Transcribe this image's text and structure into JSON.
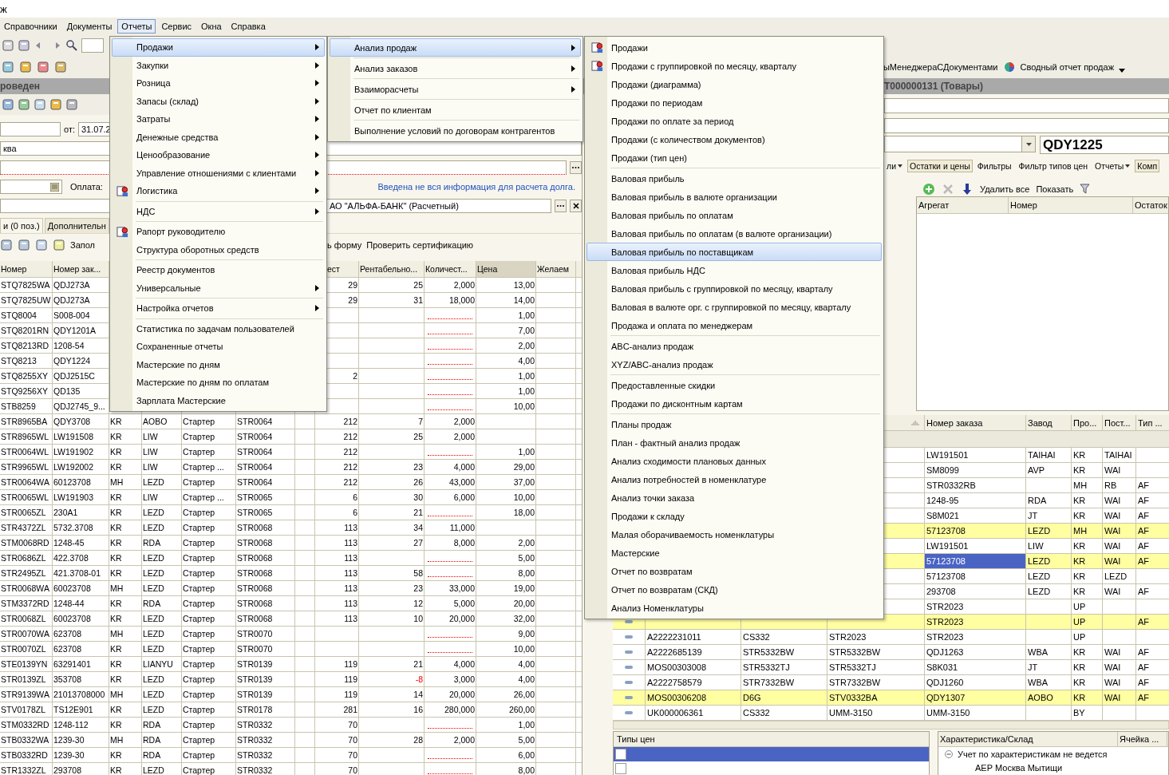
{
  "window": {
    "title": "ж"
  },
  "menubar": [
    {
      "label": "Справочники",
      "selected": false
    },
    {
      "label": "Документы",
      "selected": false
    },
    {
      "label": "Отчеты",
      "selected": true
    },
    {
      "label": "Сервис",
      "selected": false
    },
    {
      "label": "Окна",
      "selected": false
    },
    {
      "label": "Справка",
      "selected": false
    }
  ],
  "quick_reports": {
    "cut_item": "ыМенеджераСДокументами",
    "summary": "Сводный отчет продаж"
  },
  "document_header": {
    "left_title": "роведен",
    "right_title": "T000000131 (Товары)"
  },
  "form": {
    "date_label": "от:",
    "date_value": "31.07.2",
    "field_2": "ква",
    "payment_label": "Оплата:",
    "debt_link": "Введена не вся информация для расчета долга.",
    "bank_account": "АО \"АЛЬФА-БАНК\" (Расчетный)"
  },
  "tabs": [
    {
      "label": "и (0 поз.)",
      "selected": true
    },
    {
      "label": "Дополнительн",
      "selected": false
    }
  ],
  "goods_toolbar": {
    "fill": "Запол",
    "form": "ь форму",
    "check": "Проверить сертификацию"
  },
  "goods_table": {
    "headers": [
      {
        "label": "Номер",
        "selected": false
      },
      {
        "label": "Номер зак...",
        "selected": false
      },
      {
        "label": "ест",
        "selected": false
      },
      {
        "label": "Рентабельно...",
        "selected": false
      },
      {
        "label": "Количест...",
        "selected": false
      },
      {
        "label": "Цена",
        "selected": true
      },
      {
        "label": "Желаем",
        "selected": false
      }
    ],
    "rows": [
      [
        "STQ7825WA",
        "QDJ273A",
        null,
        null,
        null,
        null,
        null,
        "29",
        "25",
        "2,000",
        "13,00",
        null
      ],
      [
        "STQ7825UW",
        "QDJ273A",
        null,
        null,
        null,
        null,
        null,
        "29",
        "31",
        "18,000",
        "14,00",
        null
      ],
      [
        "STQ8004",
        "S008-004",
        null,
        null,
        null,
        null,
        null,
        null,
        null,
        null,
        "1,00",
        null
      ],
      [
        "STQ8201RN",
        "QDY1201A",
        null,
        null,
        null,
        null,
        null,
        null,
        null,
        null,
        "7,00",
        null
      ],
      [
        "STQ8213RD",
        "1208-54",
        null,
        null,
        null,
        null,
        null,
        null,
        null,
        null,
        "2,00",
        null
      ],
      [
        "STQ8213",
        "QDY1224",
        null,
        null,
        null,
        null,
        null,
        null,
        null,
        null,
        "4,00",
        null
      ],
      [
        "STQ8255XY",
        "QDJ2515C",
        null,
        null,
        null,
        null,
        null,
        "2",
        null,
        null,
        "1,00",
        null
      ],
      [
        "STQ9256XY",
        "QD135",
        null,
        null,
        null,
        null,
        null,
        null,
        null,
        null,
        "1,00",
        null
      ],
      [
        "STB8259",
        "QDJ2745_9...",
        null,
        null,
        null,
        null,
        null,
        null,
        null,
        null,
        "10,00",
        null
      ],
      [
        "STR8965BA",
        "QDY3708",
        "KR",
        "AOBO",
        "Стартер",
        "STR0064",
        null,
        "212",
        "7",
        "2,000",
        null,
        null
      ],
      [
        "STR8965WL",
        "LW191508",
        "KR",
        "LIW",
        "Стартер",
        "STR0064",
        null,
        "212",
        "25",
        "2,000",
        null,
        null
      ],
      [
        "STR0064WL",
        "LW191902",
        "KR",
        "LIW",
        "Стартер",
        "STR0064",
        null,
        "212",
        null,
        null,
        "1,00",
        null
      ],
      [
        "STR9965WL",
        "LW192002",
        "KR",
        "LIW",
        "Стартер ...",
        "STR0064",
        null,
        "212",
        "23",
        "4,000",
        "29,00",
        null
      ],
      [
        "STR0064WA",
        "60123708",
        "MH",
        "LEZD",
        "Стартер",
        "STR0064",
        null,
        "212",
        "26",
        "43,000",
        "37,00",
        null
      ],
      [
        "STR0065WL",
        "LW191903",
        "KR",
        "LIW",
        "Стартер ...",
        "STR0065",
        null,
        "6",
        "30",
        "6,000",
        "10,00",
        null
      ],
      [
        "STR0065ZL",
        "230A1",
        "KR",
        "LEZD",
        "Стартер",
        "STR0065",
        null,
        "6",
        "21",
        null,
        "18,00",
        null
      ],
      [
        "STR4372ZL",
        "5732.3708",
        "KR",
        "LEZD",
        "Стартер",
        "STR0068",
        null,
        "113",
        "34",
        "11,000",
        null,
        null
      ],
      [
        "STM0068RD",
        "1248-45",
        "KR",
        "RDA",
        "Стартер",
        "STR0068",
        null,
        "113",
        "27",
        "8,000",
        "2,00",
        null
      ],
      [
        "STR0686ZL",
        "422.3708",
        "KR",
        "LEZD",
        "Стартер",
        "STR0068",
        null,
        "113",
        null,
        null,
        "5,00",
        null
      ],
      [
        "STR2495ZL",
        "421.3708-01",
        "KR",
        "LEZD",
        "Стартер",
        "STR0068",
        null,
        "113",
        "58",
        null,
        "8,00",
        null
      ],
      [
        "STR0068WA",
        "60023708",
        "MH",
        "LEZD",
        "Стартер",
        "STR0068",
        null,
        "113",
        "23",
        "33,000",
        "19,00",
        null
      ],
      [
        "STM3372RD",
        "1248-44",
        "KR",
        "RDA",
        "Стартер",
        "STR0068",
        null,
        "113",
        "12",
        "5,000",
        "20,00",
        null
      ],
      [
        "STR0068ZL",
        "60023708",
        "KR",
        "LEZD",
        "Стартер",
        "STR0068",
        null,
        "113",
        "10",
        "20,000",
        "32,00",
        null
      ],
      [
        "STR0070WA",
        "623708",
        "MH",
        "LEZD",
        "Стартер",
        "STR0070",
        null,
        null,
        null,
        null,
        "9,00",
        null
      ],
      [
        "STR0070ZL",
        "623708",
        "KR",
        "LEZD",
        "Стартер",
        "STR0070",
        null,
        null,
        null,
        null,
        "10,00",
        null
      ],
      [
        "STE0139YN",
        "63291401",
        "KR",
        "LIANYU",
        "Стартер",
        "STR0139",
        null,
        "119",
        "21",
        "4,000",
        "4,00",
        null
      ],
      [
        "STR0139ZL",
        "353708",
        "KR",
        "LEZD",
        "Стартер",
        "STR0139",
        null,
        "119",
        "-8",
        "3,000",
        "4,00",
        null
      ],
      [
        "STR9139WA",
        "21013708000",
        "MH",
        "LEZD",
        "Стартер",
        "STR0139",
        null,
        "119",
        "14",
        "20,000",
        "26,00",
        null
      ],
      [
        "STV0178ZL",
        "TS12E901",
        "KR",
        "LEZD",
        "Стартер",
        "STR0178",
        null,
        "281",
        "16",
        "280,000",
        "260,00",
        null
      ],
      [
        "STM0332RD",
        "1248-112",
        "KR",
        "RDA",
        "Стартер",
        "STR0332",
        null,
        "70",
        null,
        null,
        "1,00",
        null
      ],
      [
        "STB0332WA",
        "1239-30",
        "MH",
        "RDA",
        "Стартер",
        "STR0332",
        null,
        "70",
        "28",
        "2,000",
        "5,00",
        null
      ],
      [
        "STB0332RD",
        "1239-30",
        "KR",
        "RDA",
        "Стартер",
        "STR0332",
        null,
        "70",
        null,
        null,
        "6,00",
        null
      ],
      [
        "STR1332ZL",
        "293708",
        "KR",
        "LEZD",
        "Стартер",
        "STR0332",
        null,
        "70",
        null,
        null,
        "8,00",
        null
      ]
    ]
  },
  "selection_panel": {
    "field_value": "QDY1225",
    "toolbar": [
      {
        "label": "ли",
        "kind": "dropdown"
      },
      {
        "label": "Остатки и цены",
        "kind": "pressed"
      },
      {
        "label": "Фильтры",
        "kind": "plain"
      },
      {
        "label": "Фильтр типов цен",
        "kind": "plain"
      },
      {
        "label": "Отчеты",
        "kind": "dropdown"
      },
      {
        "label": "Комп",
        "kind": "pressed"
      }
    ],
    "actions": {
      "delete_all": "Удалить все",
      "show": "Показать"
    },
    "aggregates_columns": [
      "Агрегат",
      "Номер",
      "Остаток"
    ]
  },
  "analogs_table": {
    "headers": [
      "Номер заказа",
      "Завод",
      "Про...",
      "Пост...",
      "Тип ..."
    ],
    "rows": [
      {
        "cells": [
          null,
          null,
          null,
          "LW191501",
          "TAIHAI",
          "KR",
          "TAIHAI",
          null
        ],
        "highlighted": false,
        "selected": false
      },
      {
        "cells": [
          null,
          null,
          null,
          "SM8099",
          "AVP",
          "KR",
          "WAI",
          null
        ],
        "highlighted": false,
        "selected": false
      },
      {
        "cells": [
          null,
          null,
          null,
          "STR0332RB",
          null,
          "MH",
          "RB",
          "AF"
        ],
        "highlighted": false,
        "selected": false
      },
      {
        "cells": [
          null,
          null,
          null,
          "1248-95",
          "RDA",
          "KR",
          "WAI",
          "AF"
        ],
        "highlighted": false,
        "selected": false
      },
      {
        "cells": [
          null,
          null,
          null,
          "S8M021",
          "JT",
          "KR",
          "WAI",
          "AF"
        ],
        "highlighted": false,
        "selected": false
      },
      {
        "cells": [
          null,
          null,
          null,
          "57123708",
          "LEZD",
          "MH",
          "WAI",
          "AF"
        ],
        "highlighted": true,
        "selected": false
      },
      {
        "cells": [
          null,
          null,
          null,
          "LW191501",
          "LIW",
          "KR",
          "WAI",
          "AF"
        ],
        "highlighted": false,
        "selected": false
      },
      {
        "cells": [
          null,
          null,
          null,
          "57123708",
          "LEZD",
          "KR",
          "WAI",
          "AF"
        ],
        "highlighted": true,
        "selected": true
      },
      {
        "cells": [
          null,
          null,
          null,
          "57123708",
          "LEZD",
          "KR",
          "LEZD",
          null
        ],
        "highlighted": false,
        "selected": false
      },
      {
        "cells": [
          null,
          null,
          null,
          "293708",
          "LEZD",
          "KR",
          "WAI",
          "AF"
        ],
        "highlighted": false,
        "selected": false
      },
      {
        "cells": [
          null,
          null,
          null,
          "STR2023",
          null,
          "UP",
          null,
          null
        ],
        "highlighted": false,
        "selected": false
      },
      {
        "cells": [
          null,
          null,
          null,
          "STR2023",
          null,
          "UP",
          null,
          "AF"
        ],
        "highlighted": true,
        "selected": false
      },
      {
        "cells": [
          "A2222231011",
          "CS332",
          "STR2023",
          "STR2023",
          null,
          "UP",
          null,
          null
        ],
        "highlighted": false,
        "selected": false
      },
      {
        "cells": [
          "A2222685139",
          "STR5332BW",
          "STR5332BW",
          "QDJ1263",
          "WBA",
          "KR",
          "WAI",
          "AF"
        ],
        "highlighted": false,
        "selected": false
      },
      {
        "cells": [
          "MOS00303008",
          "STR5332TJ",
          "STR5332TJ",
          "S8K031",
          "JT",
          "KR",
          "WAI",
          "AF"
        ],
        "highlighted": false,
        "selected": false
      },
      {
        "cells": [
          "A2222758579",
          "STR7332BW",
          "STR7332BW",
          "QDJ1260",
          "WBA",
          "KR",
          "WAI",
          "AF"
        ],
        "highlighted": false,
        "selected": false
      },
      {
        "cells": [
          "MOS00306208",
          "D6G",
          "STV0332BA",
          "QDY1307",
          "AOBO",
          "KR",
          "WAI",
          "AF"
        ],
        "highlighted": true,
        "selected": false
      },
      {
        "cells": [
          "UK000006361",
          "CS332",
          "UMM-3150",
          "UMM-3150",
          null,
          "BY",
          null,
          null
        ],
        "highlighted": false,
        "selected": false
      }
    ]
  },
  "price_types": {
    "header": "Типы цен",
    "rows": [
      {
        "selected": true,
        "checked": false
      },
      {
        "selected": false,
        "checked": false
      }
    ]
  },
  "characteristics": {
    "columns": [
      "Характеристика/Склад",
      "Ячейка ..."
    ],
    "tree": [
      {
        "label": "Учет по характеристикам не ведется",
        "expanded": true,
        "children": [
          {
            "label": "АЕР Москва Мытищи"
          }
        ]
      }
    ]
  },
  "menus": [
    {
      "groups": [
        [
          {
            "label": "Продажи",
            "submenu": true,
            "icon": false,
            "selected": true
          },
          {
            "label": "Закупки",
            "submenu": true,
            "icon": false,
            "selected": false
          },
          {
            "label": "Розница",
            "submenu": true,
            "icon": false,
            "selected": false
          },
          {
            "label": "Запасы (склад)",
            "submenu": true,
            "icon": false,
            "selected": false
          },
          {
            "label": "Затраты",
            "submenu": true,
            "icon": false,
            "selected": false
          },
          {
            "label": "Денежные средства",
            "submenu": true,
            "icon": false,
            "selected": false
          },
          {
            "label": "Ценообразование",
            "submenu": true,
            "icon": false,
            "selected": false
          },
          {
            "label": "Управление отношениями с клиентами",
            "submenu": true,
            "icon": false,
            "selected": false
          },
          {
            "label": "Логистика",
            "submenu": true,
            "icon": true,
            "selected": false
          }
        ],
        [
          {
            "label": "НДС",
            "submenu": true,
            "icon": false,
            "selected": false
          }
        ],
        [
          {
            "label": "Рапорт руководителю",
            "submenu": false,
            "icon": true,
            "selected": false
          },
          {
            "label": "Структура оборотных средств",
            "submenu": false,
            "icon": false,
            "selected": false
          }
        ],
        [
          {
            "label": "Реестр документов",
            "submenu": false,
            "icon": false,
            "selected": false
          },
          {
            "label": "Универсальные",
            "submenu": true,
            "icon": false,
            "selected": false
          }
        ],
        [
          {
            "label": "Настройка отчетов",
            "submenu": true,
            "icon": false,
            "selected": false
          }
        ],
        [
          {
            "label": "Статистика по задачам пользователей",
            "submenu": false,
            "icon": false,
            "selected": false
          },
          {
            "label": "Сохраненные отчеты",
            "submenu": false,
            "icon": false,
            "selected": false
          },
          {
            "label": "Мастерские по дням",
            "submenu": false,
            "icon": false,
            "selected": false
          },
          {
            "label": "Мастерские по дням по оплатам",
            "submenu": false,
            "icon": false,
            "selected": false
          },
          {
            "label": "Зарплата Мастерские",
            "submenu": false,
            "icon": false,
            "selected": false
          }
        ]
      ]
    },
    {
      "groups": [
        [
          {
            "label": "Анализ продаж",
            "submenu": true,
            "icon": false,
            "selected": true
          }
        ],
        [
          {
            "label": "Анализ заказов",
            "submenu": true,
            "icon": false,
            "selected": false
          }
        ],
        [
          {
            "label": "Взаиморасчеты",
            "submenu": true,
            "icon": false,
            "selected": false
          }
        ],
        [
          {
            "label": "Отчет по клиентам",
            "submenu": false,
            "icon": false,
            "selected": false
          }
        ],
        [
          {
            "label": "Выполнение условий по договорам контрагентов",
            "submenu": false,
            "icon": false,
            "selected": false
          }
        ]
      ]
    },
    {
      "groups": [
        [
          {
            "label": "Продажи",
            "submenu": false,
            "icon": true,
            "selected": false
          },
          {
            "label": "Продажи с группировкой по месяцу, кварталу",
            "submenu": false,
            "icon": true,
            "selected": false
          },
          {
            "label": "Продажи (диаграмма)",
            "submenu": false,
            "icon": false,
            "selected": false
          },
          {
            "label": "Продажи по периодам",
            "submenu": false,
            "icon": false,
            "selected": false
          },
          {
            "label": "Продажи по оплате за период",
            "submenu": false,
            "icon": false,
            "selected": false
          },
          {
            "label": "Продажи (с количеством документов)",
            "submenu": false,
            "icon": false,
            "selected": false
          },
          {
            "label": "Продажи (тип цен)",
            "submenu": false,
            "icon": false,
            "selected": false
          }
        ],
        [
          {
            "label": "Валовая прибыль",
            "submenu": false,
            "icon": false,
            "selected": false
          },
          {
            "label": "Валовая прибыль в валюте организации",
            "submenu": false,
            "icon": false,
            "selected": false
          },
          {
            "label": "Валовая прибыль по оплатам",
            "submenu": false,
            "icon": false,
            "selected": false
          },
          {
            "label": "Валовая прибыль по оплатам (в валюте организации)",
            "submenu": false,
            "icon": false,
            "selected": false
          },
          {
            "label": "Валовая прибыль по поставщикам",
            "submenu": false,
            "icon": false,
            "selected": true
          },
          {
            "label": "Валовая прибыль НДС",
            "submenu": false,
            "icon": false,
            "selected": false
          },
          {
            "label": "Валовая прибыль с группировкой по месяцу, кварталу",
            "submenu": false,
            "icon": false,
            "selected": false
          },
          {
            "label": "Валовая в валюте орг. с группировкой по месяцу, кварталу",
            "submenu": false,
            "icon": false,
            "selected": false
          },
          {
            "label": "Продажа и оплата по менеджерам",
            "submenu": false,
            "icon": false,
            "selected": false
          }
        ],
        [
          {
            "label": "ABC-анализ продаж",
            "submenu": false,
            "icon": false,
            "selected": false
          },
          {
            "label": "XYZ/ABC-анализ продаж",
            "submenu": false,
            "icon": false,
            "selected": false
          }
        ],
        [
          {
            "label": "Предоставленные скидки",
            "submenu": false,
            "icon": false,
            "selected": false
          },
          {
            "label": "Продажи по дисконтным картам",
            "submenu": false,
            "icon": false,
            "selected": false
          }
        ],
        [
          {
            "label": "Планы продаж",
            "submenu": false,
            "icon": false,
            "selected": false
          },
          {
            "label": "План - фактный анализ продаж",
            "submenu": false,
            "icon": false,
            "selected": false
          },
          {
            "label": "Анализ сходимости плановых данных",
            "submenu": false,
            "icon": false,
            "selected": false
          },
          {
            "label": "Анализ потребностей в номенклатуре",
            "submenu": false,
            "icon": false,
            "selected": false
          },
          {
            "label": "Анализ точки заказа",
            "submenu": false,
            "icon": false,
            "selected": false
          },
          {
            "label": "Продажи к складу",
            "submenu": false,
            "icon": false,
            "selected": false
          },
          {
            "label": "Малая оборачиваемость номенклатуры",
            "submenu": false,
            "icon": false,
            "selected": false
          },
          {
            "label": "Мастерские",
            "submenu": false,
            "icon": false,
            "selected": false
          },
          {
            "label": "Отчет по возвратам",
            "submenu": false,
            "icon": false,
            "selected": false
          },
          {
            "label": "Отчет по возвратам (СКД)",
            "submenu": false,
            "icon": false,
            "selected": false
          },
          {
            "label": "Анализ Номенклатуры",
            "submenu": false,
            "icon": false,
            "selected": false
          }
        ]
      ]
    }
  ]
}
